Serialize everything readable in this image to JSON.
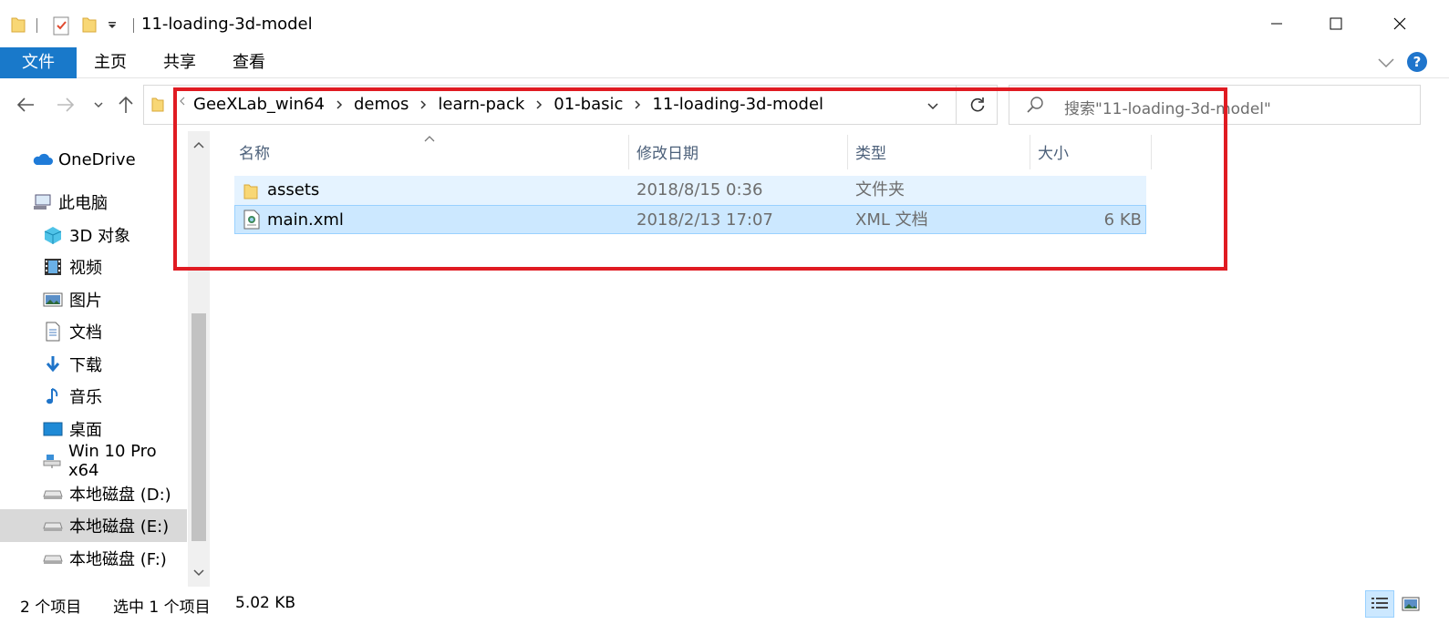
{
  "window": {
    "title": "11-loading-3d-model"
  },
  "ribbon": {
    "tabs": [
      {
        "label": "文件"
      },
      {
        "label": "主页"
      },
      {
        "label": "共享"
      },
      {
        "label": "查看"
      }
    ],
    "help_label": "?"
  },
  "address": {
    "crumbs": [
      "GeeXLab_win64",
      "demos",
      "learn-pack",
      "01-basic",
      "11-loading-3d-model"
    ]
  },
  "search": {
    "placeholder": "搜索\"11-loading-3d-model\""
  },
  "sidebar": {
    "items": [
      {
        "label": "OneDrive",
        "icon": "onedrive-icon"
      },
      {
        "label": "此电脑",
        "icon": "this-pc-icon"
      },
      {
        "label": "3D 对象",
        "icon": "3d-objects-icon"
      },
      {
        "label": "视频",
        "icon": "videos-icon"
      },
      {
        "label": "图片",
        "icon": "pictures-icon"
      },
      {
        "label": "文档",
        "icon": "documents-icon"
      },
      {
        "label": "下载",
        "icon": "downloads-icon"
      },
      {
        "label": "音乐",
        "icon": "music-icon"
      },
      {
        "label": "桌面",
        "icon": "desktop-icon"
      },
      {
        "label": "Win 10 Pro x64",
        "icon": "network-drive-icon"
      },
      {
        "label": "本地磁盘 (D:)",
        "icon": "drive-icon"
      },
      {
        "label": "本地磁盘 (E:)",
        "icon": "drive-icon",
        "selected": true
      },
      {
        "label": "本地磁盘 (F:)",
        "icon": "drive-icon"
      }
    ]
  },
  "columns": {
    "name": "名称",
    "modified": "修改日期",
    "type": "类型",
    "size": "大小"
  },
  "files": [
    {
      "name": "assets",
      "modified": "2018/8/15 0:36",
      "type": "文件夹",
      "size": "",
      "icon": "folder-icon"
    },
    {
      "name": "main.xml",
      "modified": "2018/2/13 17:07",
      "type": "XML 文档",
      "size": "6 KB",
      "icon": "xml-file-icon"
    }
  ],
  "status": {
    "item_count": "2 个项目",
    "selected": "选中 1 个项目",
    "selected_size": "5.02 KB"
  },
  "colors": {
    "accent": "#1979ca",
    "selection": "#cce8ff",
    "hover": "#e5f3ff",
    "highlight_box": "#e01b22"
  }
}
